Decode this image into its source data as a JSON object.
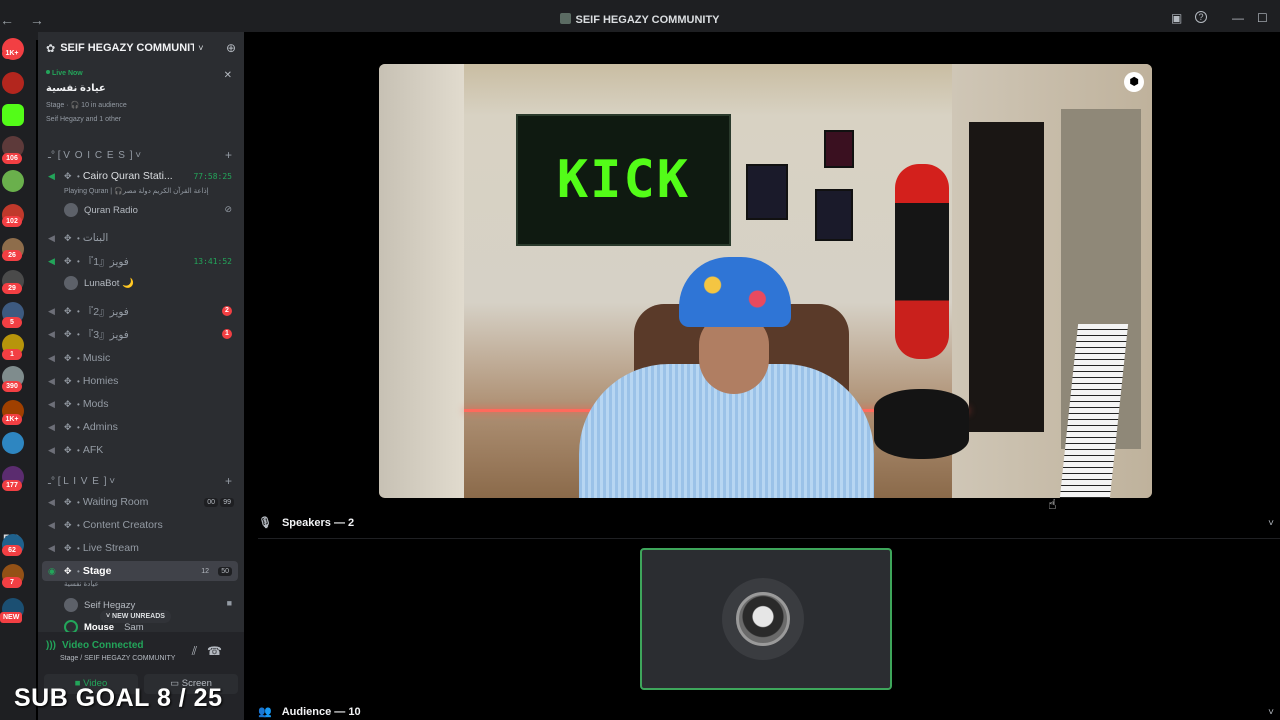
{
  "window": {
    "title": "SEIF HEGAZY COMMUNITY",
    "nav": "← →",
    "controls": {
      "inbox": "▣",
      "help": "?",
      "minimize": "—",
      "maximize": "☐"
    }
  },
  "rail": {
    "badges": [
      "1K+",
      "106",
      "102",
      "26",
      "29",
      "5",
      "1",
      "390",
      "1K+",
      "177",
      "62",
      "7"
    ],
    "pc_label": "PC",
    "new_label": "NEW"
  },
  "server": {
    "name": "SEIF HEGAZY COMMUNITY"
  },
  "live_card": {
    "status": "Live Now",
    "title": "عيادة نفسية",
    "meta": "Stage · 🎧 10 in audience",
    "hosts": "Seif Hegazy and 1 other"
  },
  "categories": {
    "voices": "ـ° [ V O I C E S ] ˅",
    "live": "ـ° [ L I V E ] ˅"
  },
  "channels": {
    "cairo": {
      "label": "Cairo Quran Stati...",
      "timer": "77:58:25",
      "sub": "Playing Quran | 🎧إذاعة القرآن الكريم دولة مصر"
    },
    "quran_radio": "Quran Radio",
    "albanat": "البنات",
    "fawiz1": {
      "label": "『1』فويز",
      "timer": "13:41:52"
    },
    "lunabot": "LunaBot 🌙",
    "fawiz2": {
      "label": "『2』فويز",
      "badge": "2"
    },
    "fawiz3": {
      "label": "『3』فويز",
      "badge": "1"
    },
    "music": "Music",
    "homies": "Homies",
    "mods": "Mods",
    "admins": "Admins",
    "afk": "AFK",
    "waiting": {
      "label": "Waiting Room",
      "count": "00",
      "limit": "99"
    },
    "creators": "Content Creators",
    "livestream": "Live Stream",
    "stage": {
      "label": "Stage",
      "count": "12",
      "limit": "50",
      "sub": "عيادة نفسية"
    },
    "member_seif": "Seif Hegazy",
    "member_mouse": "Mouse",
    "member_sam": "Sam",
    "new_unreads": "NEW UNREADS"
  },
  "voice_panel": {
    "status": "Video Connected",
    "location": "Stage / SEIF HEGAZY COMMUNITY",
    "video_btn": "Video",
    "screen_btn": "Screen"
  },
  "overlay": {
    "sub_goal": "SUB GOAL 8 / 25"
  },
  "stage": {
    "flag_text": "KICK",
    "speakers": "Speakers — 2",
    "audience": "Audience — 10"
  },
  "colors": {
    "accent_green": "#23a55a",
    "kick_green": "#53fc18",
    "badge_red": "#f23f43",
    "sidebar_bg": "#2b2d31"
  }
}
